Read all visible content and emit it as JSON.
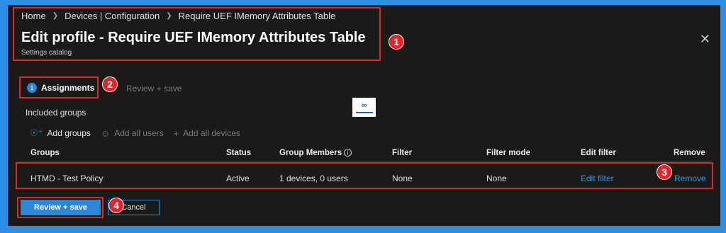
{
  "breadcrumb": [
    "Home",
    "Devices | Configuration",
    "Require UEF IMemory Attributes Table"
  ],
  "header": {
    "title": "Edit profile - Require UEF IMemory Attributes Table",
    "subtitle": "Settings catalog",
    "close_icon": "close-icon"
  },
  "steps": [
    {
      "number": "1",
      "label": "Assignments",
      "active": true
    },
    {
      "label": "Review + save",
      "active": false
    }
  ],
  "included_groups_label": "Included groups",
  "actions": [
    {
      "label": "Add groups",
      "icon": "add-group-icon",
      "enabled": true
    },
    {
      "label": "Add all users",
      "icon": "users-icon",
      "enabled": false
    },
    {
      "label": "Add all devices",
      "icon": "plus-icon",
      "enabled": false
    }
  ],
  "table": {
    "columns": [
      "Groups",
      "Status",
      "Group Members",
      "Filter",
      "Filter mode",
      "Edit filter",
      "Remove"
    ],
    "rows": [
      {
        "group": "HTMD - Test Policy",
        "status": "Active",
        "members": "1 devices, 0 users",
        "filter": "None",
        "filter_mode": "None",
        "edit_filter": "Edit filter",
        "remove": "Remove"
      }
    ]
  },
  "buttons": {
    "primary": "Review + save",
    "secondary": "Cancel"
  },
  "callouts": [
    "1",
    "2",
    "3",
    "4"
  ],
  "colors": {
    "accent": "#2b88d8",
    "callout": "#e3232c",
    "panel_bg": "#1b1a19",
    "frame": "#2e8fe6"
  }
}
